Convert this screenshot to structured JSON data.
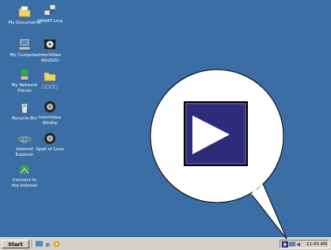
{
  "desktop": {
    "background": "#3a6ea5",
    "icons": [
      {
        "id": "my-documents",
        "label": "My Documents",
        "icon": "folder-icon"
      },
      {
        "id": "smart-linq",
        "label": "SMART-Linq",
        "icon": "network-icon"
      },
      {
        "id": "my-computer",
        "label": "My Computer",
        "icon": "computer-icon"
      },
      {
        "id": "intervideo-windvd",
        "label": "InterVideo\nWinDVD",
        "icon": "windvd-icon"
      },
      {
        "id": "my-network-places",
        "label": "My Network\nPlaces",
        "icon": "network-places-icon"
      },
      {
        "id": "folder-boxes",
        "label": "□□□□",
        "icon": "folder-icon"
      },
      {
        "id": "recycle-bin",
        "label": "Recycle Bin",
        "icon": "recycle-bin-icon"
      },
      {
        "id": "intervideo-winrip",
        "label": "InterVideo\nWinRip",
        "icon": "winrip-icon"
      },
      {
        "id": "internet-explorer",
        "label": "Internet\nExplorer",
        "icon": "internet-explorer-icon"
      },
      {
        "id": "spell-of-love",
        "label": "Spell of Love",
        "icon": "music-disc-icon"
      },
      {
        "id": "connect-to-internet",
        "label": "Connect to\nthe Internet",
        "icon": "connect-internet-icon"
      }
    ]
  },
  "taskbar": {
    "start_label": "Start",
    "clock": "11:43 AM",
    "quick_launch": [
      "desktop-icon",
      "internet-explorer-icon",
      "media-icon"
    ],
    "tray": [
      "windvd-tray-icon",
      "network-tray-icon",
      "volume-icon"
    ]
  },
  "callout": {
    "icon": "play-icon",
    "colors": {
      "fill": "#ffffff",
      "button": "#2c2c7a",
      "arrow": "#ffffff"
    }
  }
}
